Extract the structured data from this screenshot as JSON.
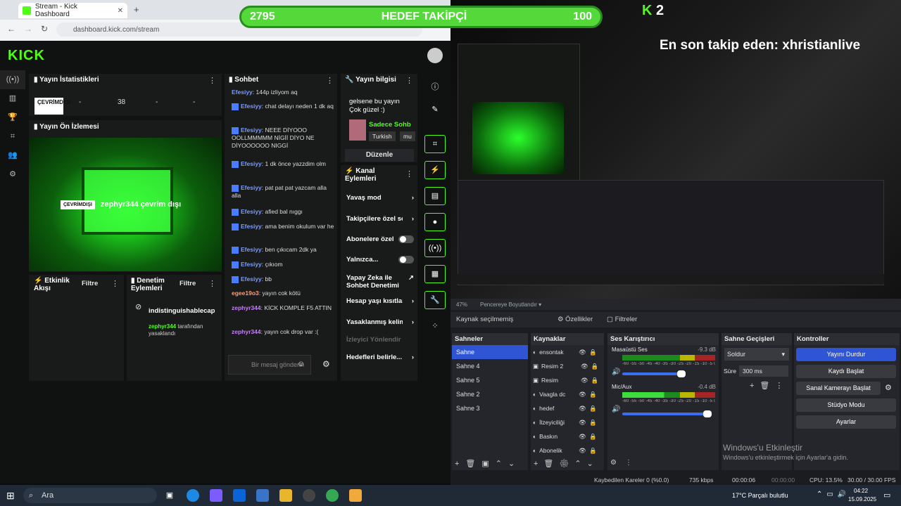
{
  "browser": {
    "tab_title": "Stream - Kick Dashboard",
    "url": "dashboard.kick.com/stream"
  },
  "dashboard": {
    "logo": "KICK",
    "stats": {
      "title": "Yayın İstatistikleri",
      "offline": "ÇEVRİMDIŞI",
      "values": [
        "-",
        "38",
        "-",
        "-"
      ]
    },
    "preview": {
      "title": "Yayın Ön İzlemesi",
      "tag": "ÇEVRİMDIŞI",
      "text": "zephyr344 çevrim dışı"
    },
    "activity": {
      "title": "Etkinlik Akışı",
      "filter": "Filtre"
    },
    "moderation": {
      "title": "Denetim Eylemleri",
      "filter": "Filtre",
      "user": "indistinguishablecap",
      "by_user": "zephyr344",
      "action": "tarafından yasaklandı"
    },
    "chat": {
      "title": "Sohbet",
      "messages": [
        {
          "user": "Efesiyy",
          "text": "144p izliyom aq"
        },
        {
          "user": "Efesiyy",
          "text": "chat delayı neden 1 dk aq"
        },
        {
          "user": "Efesiyy",
          "text": "NEEE DİYOOO OOLLMMMMM NİGİİ DİYO NE DİYOOOOOO NIGGİ"
        },
        {
          "user": "Efesiyy",
          "text": "1 dk önce yazzdim olm"
        },
        {
          "user": "Efesiyy",
          "text": "pat pat pat yazcam alla alla"
        },
        {
          "user": "Efesiyy",
          "text": "afied bal nıggı"
        },
        {
          "user": "Efesiyy",
          "text": "ama benim okulum var he"
        },
        {
          "user": "Efesiyy",
          "text": "ben çıkıcam 2dk ya"
        },
        {
          "user": "Efesiyy",
          "text": "çıkıom"
        },
        {
          "user": "Efesiyy",
          "text": "bb"
        },
        {
          "user": "egee19o3",
          "text": "yayın cok kötü"
        },
        {
          "user": "zephyr344",
          "text": "KİCK KOMPLE F5 ATTIN"
        },
        {
          "user": "zephyr344",
          "text": "yayın cok drop var :("
        }
      ],
      "placeholder": "Bir mesaj gönderin"
    },
    "stream_info": {
      "title": "Yayın bilgisi",
      "text": "gelsene bu yayın Çok güzel :)",
      "category": "Sadece Sohb",
      "tags": [
        "Turkish",
        "mu"
      ],
      "edit": "Düzenle"
    },
    "channel_actions": {
      "title": "Kanal Eylemleri",
      "items": [
        "Yavaş mod",
        "Takipçilere özel sohbet",
        "Abonelere özel",
        "Yalnızca...",
        "Yapay Zeka ile Sohbet Denetimi",
        "Hesap yaşı kısıtlama",
        "Yasaklanmış kelimeler",
        "İzleyici Yönlendir",
        "Hedefleri belirle..."
      ]
    }
  },
  "overlay": {
    "follow_current": "2795",
    "follow_label": "HEDEF TAKİPÇİ",
    "follow_goal": "100",
    "kick_count": "2",
    "last_follow": "En son takip eden: xhristianlive"
  },
  "obs": {
    "zoom": "47%",
    "window_label": "Pencereye Boyutlandır",
    "no_source": "Kaynak seçilmemiş",
    "properties": "Özellikler",
    "filters": "Filtreler",
    "scenes": {
      "title": "Sahneler",
      "items": [
        "Sahne",
        "Sahne 4",
        "Sahne 5",
        "Sahne 2",
        "Sahne 3"
      ]
    },
    "sources": {
      "title": "Kaynaklar",
      "items": [
        "ensontak",
        "Resim 2",
        "Resim",
        "Vaagla dc",
        "hedef",
        "İlzeyiciliği",
        "Baskın",
        "Abonelik"
      ]
    },
    "mixer": {
      "title": "Ses Karıştırıcı",
      "channels": [
        {
          "name": "Masaüstü Ses",
          "db": "-9.3 dB",
          "level": 0.62
        },
        {
          "name": "Mic/Aux",
          "db": "-0.4 dB",
          "level": 0.45
        }
      ],
      "scale": "-60 -55 -50 -45 -40 -35 -30 -25 -20 -15 -10 -5 0"
    },
    "transitions": {
      "title": "Sahne Geçişleri",
      "type": "Soldur",
      "duration_label": "Süre",
      "duration": "300 ms"
    },
    "controls": {
      "title": "Kontroller",
      "items": [
        "Yayını Durdur",
        "Kaydı Başlat",
        "Sanal Kamerayı Başlat",
        "Stüdyo Modu",
        "Ayarlar"
      ]
    },
    "status": {
      "dropped": "Kaybedilen Kareler 0 (%0.0)",
      "kbps": "735 kbps",
      "stream_time": "00:00:06",
      "rec_time": "00:00:00",
      "cpu": "CPU: 13.5%",
      "fps": "30.00 / 30.00 FPS"
    }
  },
  "watermark": {
    "line1": "Windows'u Etkinleştir",
    "line2": "Windows'u etkinleştirmek için Ayarlar'a gidin."
  },
  "taskbar": {
    "search": "Ara",
    "weather": "17°C Parçalı bulutlu",
    "time": "04:22",
    "date": "15.09.2025"
  },
  "colors": {
    "kick_green": "#53fc18",
    "obs_accent": "#2f55d4"
  }
}
